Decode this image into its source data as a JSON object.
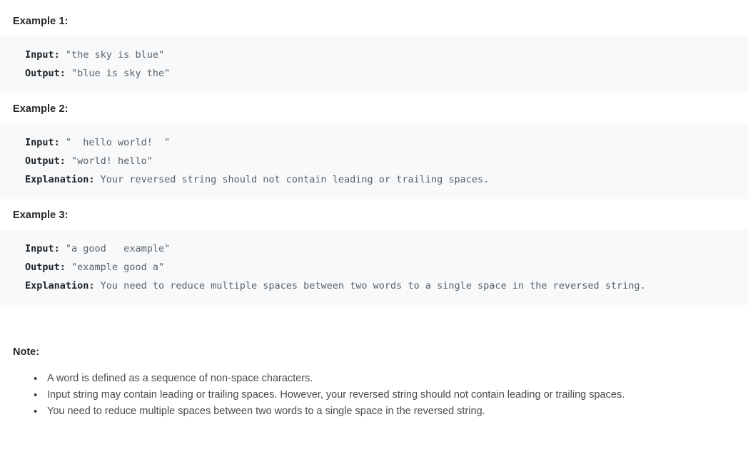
{
  "examples": [
    {
      "heading": "Example 1:",
      "lines": [
        {
          "label": "Input:",
          "value": " \"the sky is blue\""
        },
        {
          "label": "Output:",
          "value": " \"blue is sky the\""
        }
      ]
    },
    {
      "heading": "Example 2:",
      "lines": [
        {
          "label": "Input:",
          "value": " \"  hello world!  \""
        },
        {
          "label": "Output:",
          "value": " \"world! hello\""
        },
        {
          "label": "Explanation:",
          "value": " Your reversed string should not contain leading or trailing spaces."
        }
      ]
    },
    {
      "heading": "Example 3:",
      "lines": [
        {
          "label": "Input:",
          "value": " \"a good   example\""
        },
        {
          "label": "Output:",
          "value": " \"example good a\""
        },
        {
          "label": "Explanation:",
          "value": " You need to reduce multiple spaces between two words to a single space in the reversed string."
        }
      ]
    }
  ],
  "note": {
    "heading": "Note:",
    "bullet_glyph": "•",
    "items": [
      "A word is defined as a sequence of non-space characters.",
      "Input string may contain leading or trailing spaces. However, your reversed string should not contain leading or trailing spaces.",
      "You need to reduce multiple spaces between two words to a single space in the reversed string."
    ]
  },
  "colors": {
    "code_background": "#f7f9fa",
    "page_background": "#ffffff",
    "heading_text": "#262626",
    "code_text": "#5c6368",
    "code_label": "#1f2326",
    "note_text": "#4a4a4a"
  }
}
